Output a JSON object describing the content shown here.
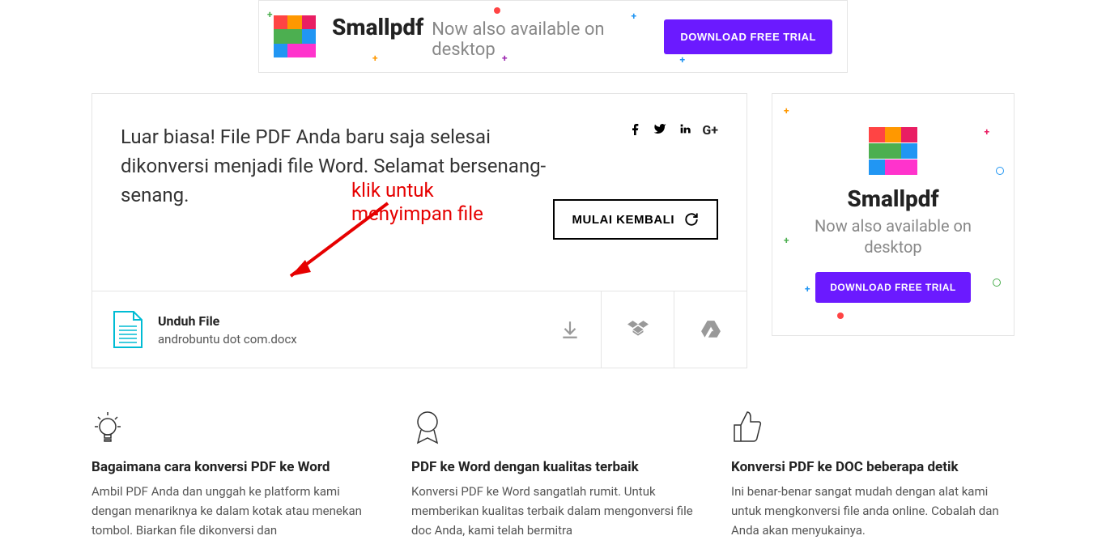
{
  "top_banner": {
    "brand": "Smallpdf",
    "tagline": "Now also available on desktop",
    "cta": "DOWNLOAD FREE TRIAL"
  },
  "main": {
    "success_message": "Luar biasa! File PDF Anda baru saja selesai dikonversi menjadi file Word. Selamat bersenang-senang.",
    "annotation_line1": "klik untuk",
    "annotation_line2": "menyimpan file",
    "restart_label": "MULAI KEMBALI",
    "download": {
      "title": "Unduh File",
      "filename": "androbuntu dot com.docx"
    }
  },
  "side_banner": {
    "brand": "Smallpdf",
    "tagline": "Now also available on desktop",
    "cta": "DOWNLOAD FREE TRIAL"
  },
  "features": [
    {
      "title": "Bagaimana cara konversi PDF ke Word",
      "desc": "Ambil PDF Anda dan unggah ke platform kami dengan menariknya ke dalam kotak atau menekan tombol. Biarkan file dikonversi dan"
    },
    {
      "title": "PDF ke Word dengan kualitas terbaik",
      "desc": "Konversi PDF ke Word sangatlah rumit. Untuk memberikan kualitas terbaik dalam mengonversi file doc Anda, kami telah bermitra"
    },
    {
      "title": "Konversi PDF ke DOC beberapa detik",
      "desc": "Ini benar-benar sangat mudah dengan alat kami untuk mengkonversi file anda online. Cobalah dan Anda akan menyukainya."
    }
  ]
}
